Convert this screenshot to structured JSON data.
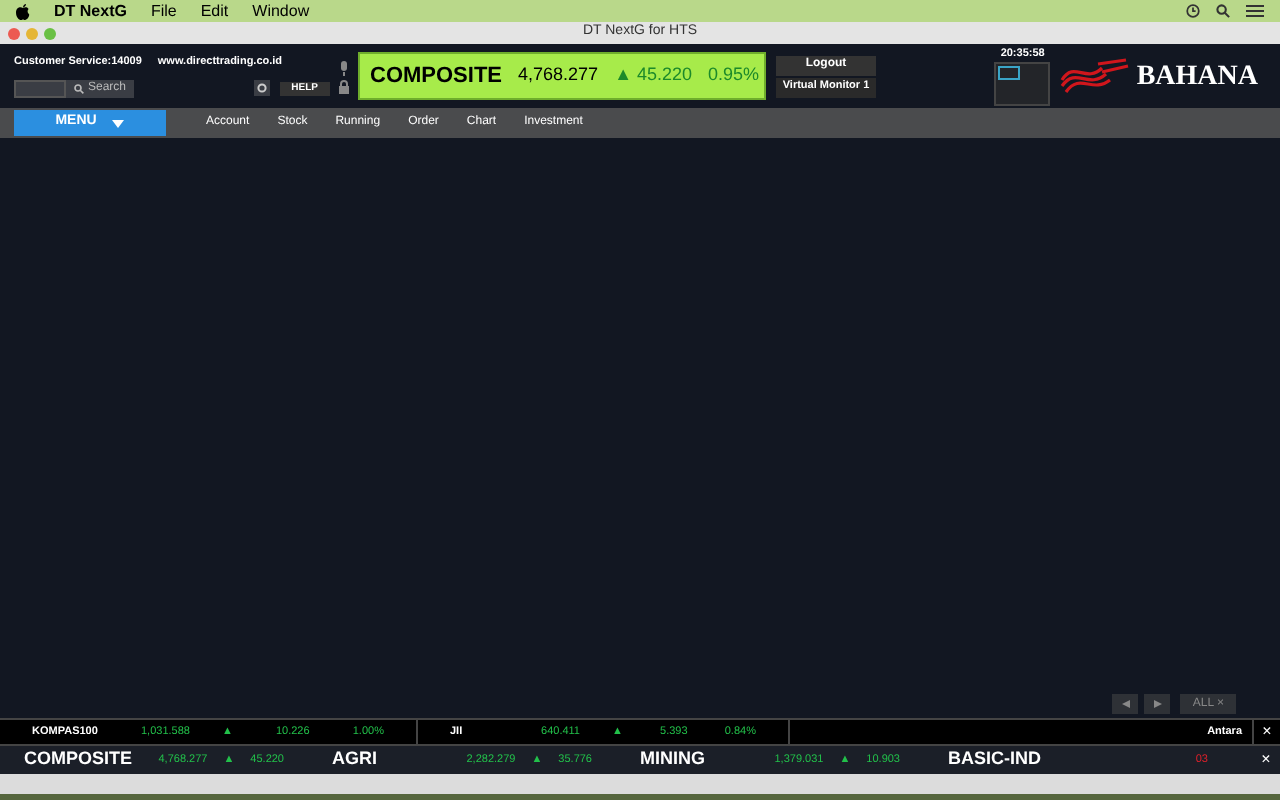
{
  "menubar": {
    "app": "DT NextG",
    "items": [
      "File",
      "Edit",
      "Window"
    ]
  },
  "window": {
    "title": "DT NextG for HTS"
  },
  "header": {
    "customer_service": "Customer Service:14009",
    "website": "www.directtrading.co.id",
    "search": {
      "placeholder": "Search"
    },
    "help": "HELP",
    "logout": "Logout",
    "virtual_monitor": "Virtual Monitor 1",
    "clock": "20:35:58",
    "brand": "BAHANA"
  },
  "index_banner": {
    "name": "COMPOSITE",
    "value": "4,768.277",
    "arrow": "▲",
    "change": "45.220",
    "percent": "0.95%"
  },
  "nav": {
    "menu": "MENU",
    "items": [
      "Account",
      "Stock",
      "Running",
      "Order",
      "Chart",
      "Investment"
    ]
  },
  "pager": {
    "all": "ALL ×"
  },
  "ticker": [
    {
      "name": "KOMPAS100",
      "value": "1,031.588",
      "arrow": "▲",
      "change": "10.226",
      "percent": "1.00%"
    },
    {
      "name": "JII",
      "value": "640.411",
      "arrow": "▲",
      "change": "5.393",
      "percent": "0.84%"
    }
  ],
  "news": {
    "source": "Antara",
    "close": "×"
  },
  "sectors": [
    {
      "name": "COMPOSITE",
      "value": "4,768.277",
      "arrow": "▲",
      "change": "45.220"
    },
    {
      "name": "AGRI",
      "value": "2,282.279",
      "arrow": "▲",
      "change": "35.776"
    },
    {
      "name": "MINING",
      "value": "1,379.031",
      "arrow": "▲",
      "change": "10.903"
    },
    {
      "name": "BASIC-IND",
      "value": "03"
    }
  ],
  "sector_close": "×"
}
